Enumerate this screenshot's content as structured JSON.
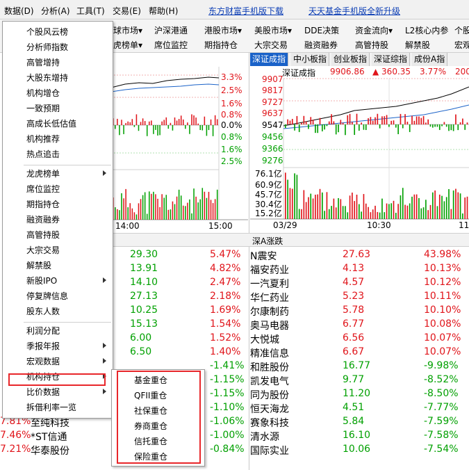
{
  "menubar": {
    "items": [
      "数据(D)",
      "分析(A)",
      "工具(T)",
      "交易(E)",
      "帮助(H)"
    ],
    "links": [
      "东方财富手机版下载",
      "天天基金手机版全新升级"
    ]
  },
  "nav": {
    "row1": [
      "球市场▾",
      "沪深港通",
      "港股市场▾",
      "美股市场▾",
      "DDE决策",
      "资金流向▾",
      "L2核心内参",
      "个股"
    ],
    "row2": [
      "虎榜单▾",
      "席位监控",
      "期指持仓",
      "大宗交易",
      "融资融券",
      "高管持股",
      "解禁股",
      "宏观"
    ]
  },
  "tabs": [
    "深证成指",
    "中小板指",
    "创业板指",
    "深证综指",
    "成份A指"
  ],
  "left_chart": {
    "pct_labels": [
      "3.3%",
      "2.5%",
      "1.6%",
      "0.8%",
      "0.0%",
      "0.8%",
      "1.6%",
      "2.5%"
    ],
    "time_labels": [
      "14:00",
      "15:00"
    ]
  },
  "right_chart": {
    "name": "深证成指",
    "value": "9906.86",
    "change": "▲ 360.35",
    "pct": "3.77%",
    "extra": "200",
    "price_labels": [
      "9907",
      "9817",
      "9727",
      "9637",
      "9547",
      "9456",
      "9366",
      "9276"
    ],
    "vol_labels": [
      "76.1亿",
      "60.9亿",
      "45.7亿",
      "30.4亿",
      "15.2亿"
    ],
    "time_labels": [
      "03/29",
      "10:30",
      "11"
    ]
  },
  "right_table_header": "深A涨跌",
  "left_rows": [
    {
      "price": "29.30",
      "pct": "5.47%"
    },
    {
      "price": "13.91",
      "pct": "4.82%"
    },
    {
      "price": "14.10",
      "pct": "2.47%"
    },
    {
      "price": "27.13",
      "pct": "2.18%"
    },
    {
      "price": "10.25",
      "pct": "1.69%"
    },
    {
      "price": "15.13",
      "pct": "1.54%"
    },
    {
      "price": "6.00",
      "pct": "1.52%"
    },
    {
      "price": "6.50",
      "pct": "1.40%"
    },
    {
      "price": "",
      "pct": "-1.41%"
    },
    {
      "price": "",
      "pct": "-1.15%"
    },
    {
      "price": "",
      "pct": "-1.15%"
    },
    {
      "price": "",
      "pct": "-1.10%"
    },
    {
      "pct0": "7.81%",
      "name": "至纯科技",
      "price": "",
      "pct": "-1.06%"
    },
    {
      "pct0": "7.46%",
      "name": "*ST信通",
      "price": "",
      "pct": "-1.00%"
    },
    {
      "pct0": "7.21%",
      "name": "华泰股份",
      "price": "",
      "pct": "-0.84%"
    }
  ],
  "right_rows": [
    {
      "name": "N震安",
      "price": "27.63",
      "pct": "43.98%"
    },
    {
      "name": "福安药业",
      "price": "4.13",
      "pct": "10.13%"
    },
    {
      "name": "一汽夏利",
      "price": "4.57",
      "pct": "10.12%"
    },
    {
      "name": "华仁药业",
      "price": "5.23",
      "pct": "10.11%"
    },
    {
      "name": "尔康制药",
      "price": "5.78",
      "pct": "10.10%"
    },
    {
      "name": "奥马电器",
      "price": "6.77",
      "pct": "10.08%"
    },
    {
      "name": "大悦城",
      "price": "6.56",
      "pct": "10.07%"
    },
    {
      "name": "精准信息",
      "price": "6.67",
      "pct": "10.07%"
    },
    {
      "name": "和胜股份",
      "price": "16.77",
      "pct": "-9.98%"
    },
    {
      "name": "凯发电气",
      "price": "9.77",
      "pct": "-8.52%"
    },
    {
      "name": "同为股份",
      "price": "11.20",
      "pct": "-8.50%"
    },
    {
      "name": "恒天海龙",
      "price": "4.51",
      "pct": "-7.77%"
    },
    {
      "name": "赛象科技",
      "price": "5.84",
      "pct": "-7.59%"
    },
    {
      "name": "清水源",
      "price": "16.10",
      "pct": "-7.58%"
    },
    {
      "name": "国际实业",
      "price": "10.06",
      "pct": "-7.54%"
    }
  ],
  "dropdown": {
    "items": [
      {
        "label": "个股风云榜",
        "arrow": false
      },
      {
        "label": "分析师指数",
        "arrow": false
      },
      {
        "label": "高管增持",
        "arrow": false
      },
      {
        "label": "大股东增持",
        "arrow": false
      },
      {
        "label": "机构增仓",
        "arrow": false
      },
      {
        "label": "一致预期",
        "arrow": false
      },
      {
        "label": "高成长低估值",
        "arrow": false
      },
      {
        "label": "机构推荐",
        "arrow": false
      },
      {
        "label": "热点追击",
        "arrow": false
      },
      {
        "label": "龙虎榜单",
        "arrow": true
      },
      {
        "label": "席位监控",
        "arrow": false
      },
      {
        "label": "期指持仓",
        "arrow": false
      },
      {
        "label": "融资融券",
        "arrow": false
      },
      {
        "label": "高管持股",
        "arrow": false
      },
      {
        "label": "大宗交易",
        "arrow": false
      },
      {
        "label": "解禁股",
        "arrow": false
      },
      {
        "label": "新股IPO",
        "arrow": true
      },
      {
        "label": "停复牌信息",
        "arrow": false
      },
      {
        "label": "股东人数",
        "arrow": false
      },
      {
        "label": "利润分配",
        "arrow": false
      },
      {
        "label": "季报年报",
        "arrow": true
      },
      {
        "label": "宏观数据",
        "arrow": true
      },
      {
        "label": "机构持仓",
        "arrow": true
      },
      {
        "label": "比价数据",
        "arrow": true
      },
      {
        "label": "拆借利率一览",
        "arrow": false
      }
    ]
  },
  "submenu": {
    "items": [
      "基金重仓",
      "QFII重仓",
      "社保重仓",
      "券商重仓",
      "信托重仓",
      "保险重仓"
    ]
  },
  "colors": {
    "accent": "#1a62c8",
    "up": "#e0141a",
    "down": "#00a000",
    "highlight": "#e8262a"
  }
}
